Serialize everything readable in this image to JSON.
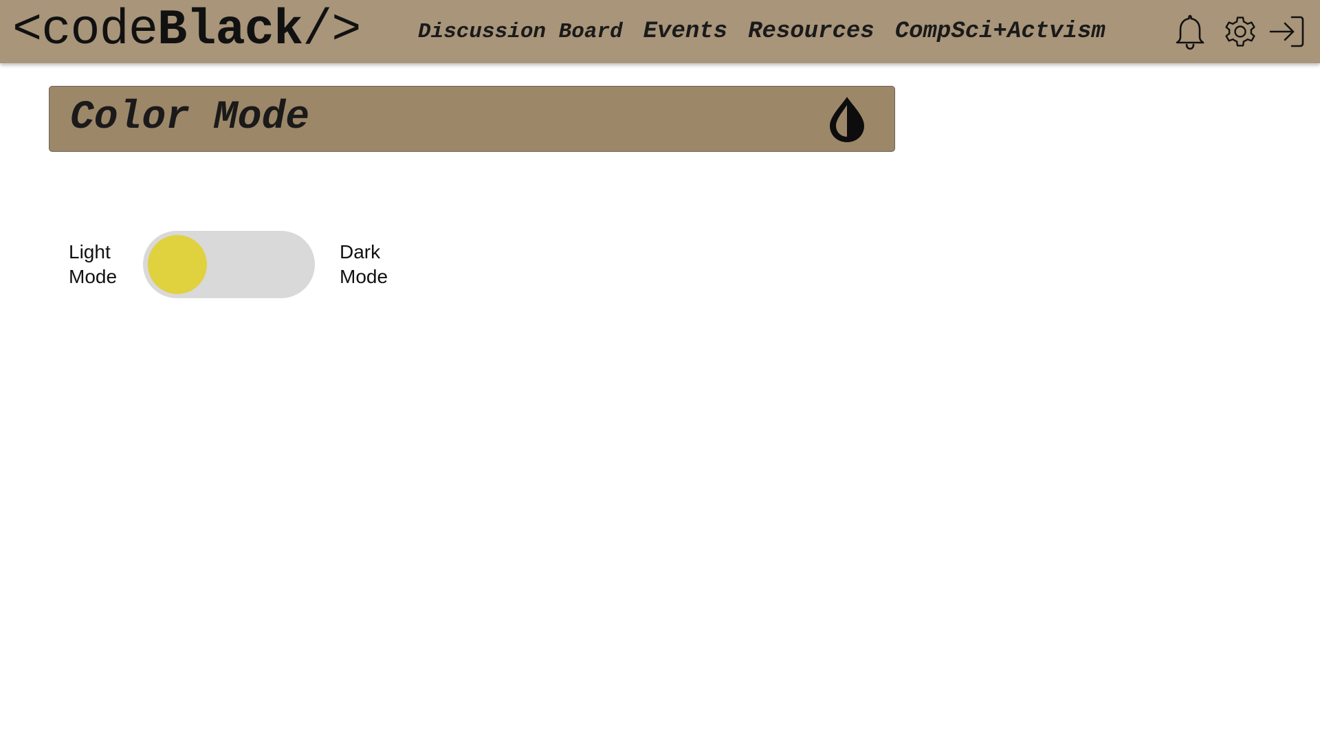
{
  "navbar": {
    "logo": {
      "prefix": "<code",
      "bold": "Black",
      "suffix": "/>"
    },
    "links": [
      {
        "label": "Discussion Board"
      },
      {
        "label": "Events"
      },
      {
        "label": "Resources"
      },
      {
        "label": "CompSci+Actvism"
      }
    ],
    "icons": [
      "bell-icon",
      "gear-icon",
      "sign-out-icon"
    ],
    "background_color": "#a8957a"
  },
  "panel": {
    "title": "Color Mode",
    "icon": "half-drop-icon",
    "background_color": "#9c8768"
  },
  "toggle": {
    "left_label_line1": "Light",
    "left_label_line2": "Mode",
    "right_label_line1": "Dark",
    "right_label_line2": "Mode",
    "state": "light",
    "track_color": "#d9d9d9",
    "knob_color": "#e0d13f"
  }
}
